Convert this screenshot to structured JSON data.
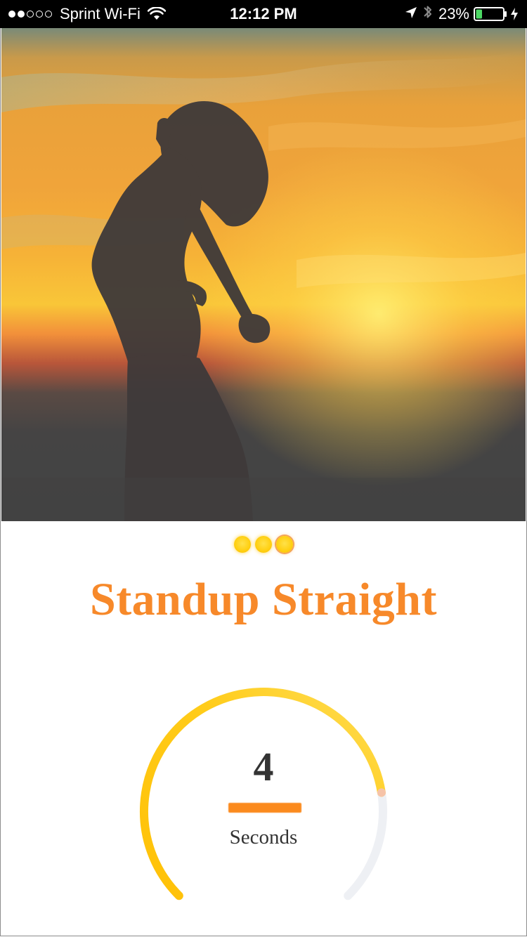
{
  "status_bar": {
    "signal_dots": [
      true,
      true,
      false,
      false,
      false
    ],
    "carrier": "Sprint Wi-Fi",
    "time": "12:12 PM",
    "battery_percent": "23%",
    "battery_level": 0.23,
    "icons": [
      "wifi-icon",
      "location-arrow-icon",
      "bluetooth-icon",
      "battery-icon",
      "charging-bolt-icon"
    ]
  },
  "hero": {
    "image": "sunset-silhouette-person-jumping"
  },
  "pagination": {
    "total": 3,
    "active_index": 2
  },
  "exercise": {
    "title": "Standup Straight"
  },
  "timer": {
    "value": "4",
    "unit": "Seconds",
    "progress": 0.8,
    "colors": {
      "progress_start": "#ffc107",
      "progress_end": "#ffd64a",
      "track": "#eef0f4",
      "accent": "#fb8a1d",
      "title": "#f7892a"
    }
  }
}
